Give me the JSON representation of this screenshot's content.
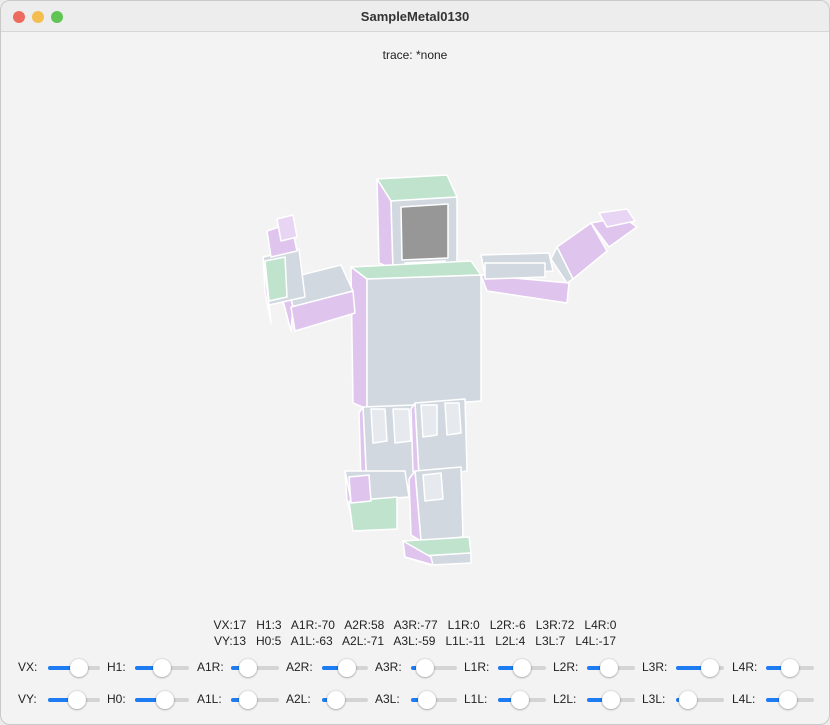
{
  "window": {
    "title": "SampleMetal0130"
  },
  "trace": {
    "label": "trace:",
    "value": "*none"
  },
  "readout": {
    "line1": "VX:17   H1:3   A1R:-70   A2R:58   A3R:-77   L1R:0   L2R:-6   L3R:72   L4R:0",
    "line2": "VY:13   H0:5   A1L:-63   A2L:-71   A3L:-59   L1L:-11   L2L:4   L3L:7   L4L:-17"
  },
  "controls": {
    "row1": [
      {
        "label": "VX:",
        "value": 0.6
      },
      {
        "label": "H1:",
        "value": 0.5
      },
      {
        "label": "A1R:",
        "value": 0.35
      },
      {
        "label": "A2R:",
        "value": 0.55
      },
      {
        "label": "A3R:",
        "value": 0.3
      },
      {
        "label": "L1R:",
        "value": 0.5
      },
      {
        "label": "L2R:",
        "value": 0.45
      },
      {
        "label": "L3R:",
        "value": 0.7
      },
      {
        "label": "L4R:",
        "value": 0.5
      }
    ],
    "row2": [
      {
        "label": "VY:",
        "value": 0.55
      },
      {
        "label": "H0:",
        "value": 0.55
      },
      {
        "label": "A1L:",
        "value": 0.35
      },
      {
        "label": "A2L:",
        "value": 0.3
      },
      {
        "label": "A3L:",
        "value": 0.35
      },
      {
        "label": "L1L:",
        "value": 0.45
      },
      {
        "label": "L2L:",
        "value": 0.5
      },
      {
        "label": "L3L:",
        "value": 0.25
      },
      {
        "label": "L4L:",
        "value": 0.45
      }
    ]
  },
  "colors": {
    "accent": "#1d7cf2",
    "face_gray": "#d1d8e0",
    "face_green": "#bfe3cc",
    "face_purple": "#dfc4ee",
    "screen": "#979797"
  }
}
